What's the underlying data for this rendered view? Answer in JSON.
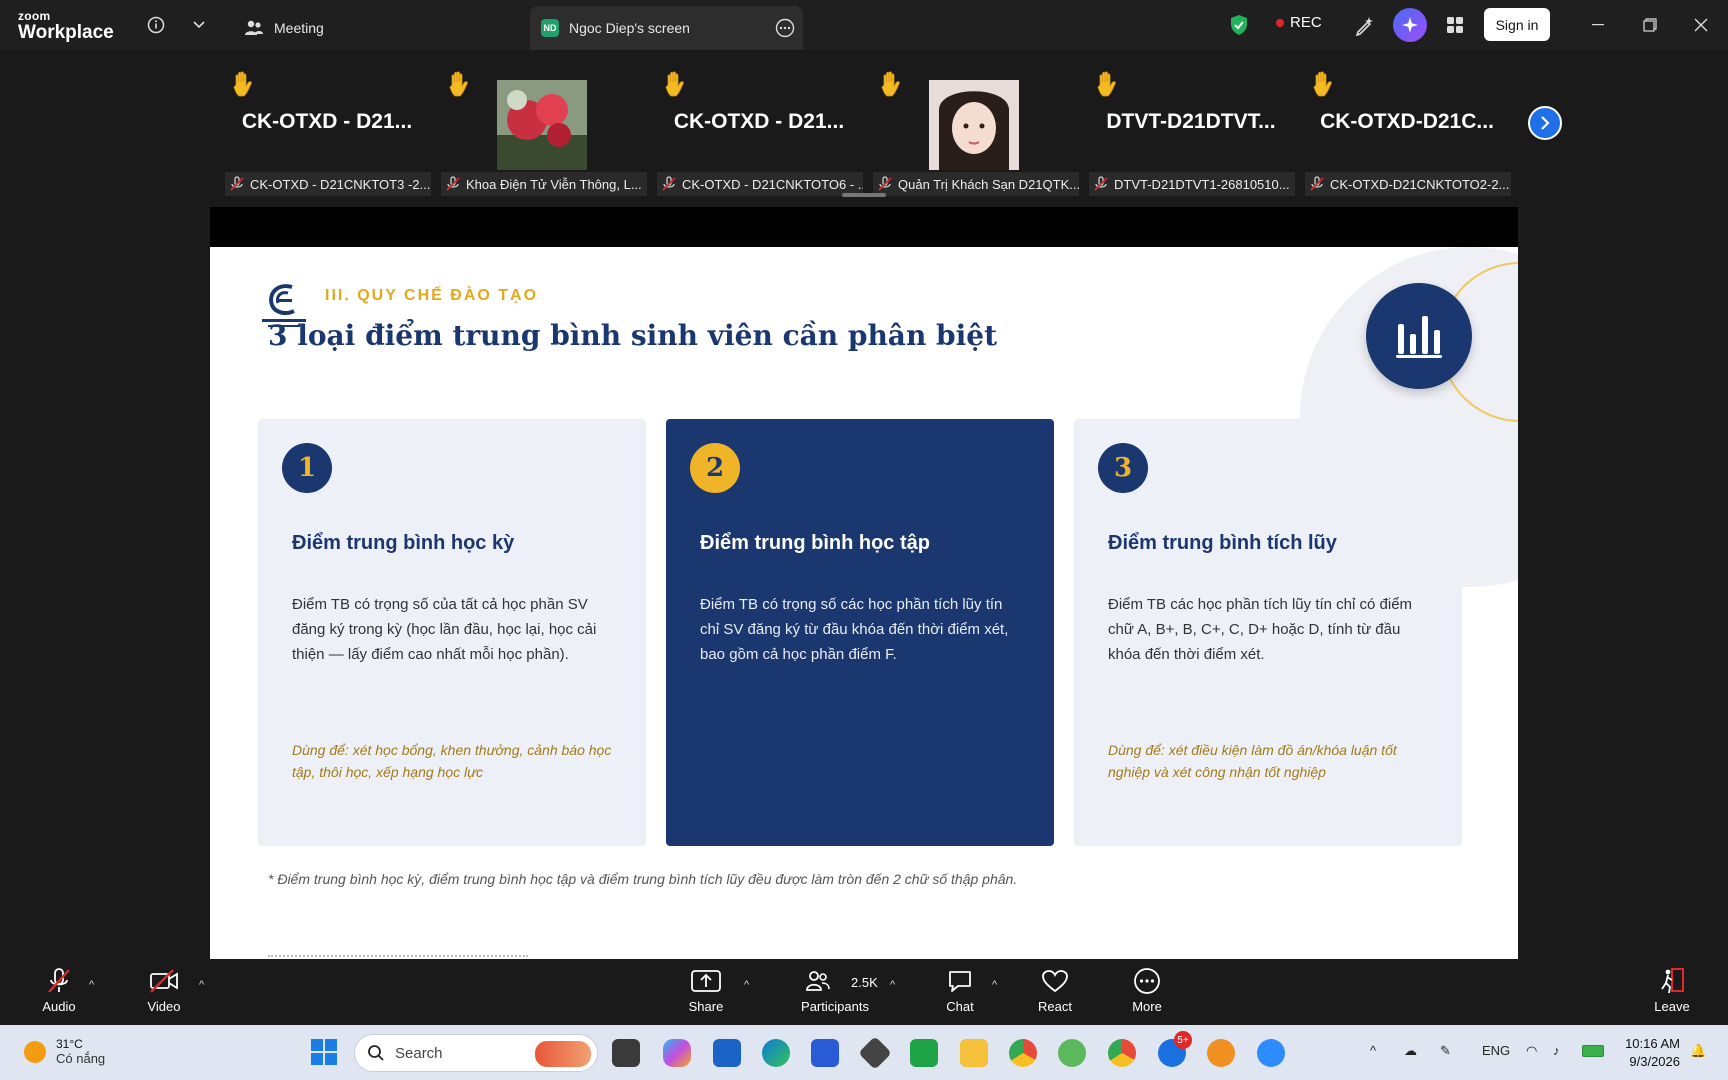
{
  "titlebar": {
    "logo_line1": "zoom",
    "logo_line2": "Workplace",
    "tab_meeting": "Meeting",
    "tab_screen_badge": "ND",
    "tab_screen": "Ngoc Diep's screen",
    "rec": "REC",
    "sign_in": "Sign in"
  },
  "participants": [
    {
      "big_name": "CK-OTXD - D21...",
      "label": "CK-OTXD - D21CNKTOT3 -2...",
      "has_photo": false
    },
    {
      "big_name": "",
      "label": "Khoa Điện Tử Viễn Thông, L...",
      "has_photo": true,
      "photo": "flower"
    },
    {
      "big_name": "CK-OTXD - D21...",
      "label": "CK-OTXD - D21CNKTOTO6 - ...",
      "has_photo": false
    },
    {
      "big_name": "",
      "label": "Quản Trị Khách Sạn D21QTK...",
      "has_photo": true,
      "photo": "girl"
    },
    {
      "big_name": "DTVT-D21DTVT...",
      "label": "DTVT-D21DTVT1-26810510...",
      "has_photo": false
    },
    {
      "big_name": "CK-OTXD-D21C...",
      "label": "CK-OTXD-D21CNKTOTO2-2...",
      "has_photo": false
    }
  ],
  "slide": {
    "section": "III. QUY CHẾ ĐÀO TẠO",
    "title": "3 loại điểm trung bình sinh viên cần phân biệt",
    "cards": [
      {
        "number": "1",
        "title": "Điểm trung bình học kỳ",
        "body": "Điểm TB có trọng số của tất cả học phần SV đăng ký trong kỳ (học lần đầu, học lại, học cải thiện — lấy điểm cao nhất mỗi học phần).",
        "use": "Dùng để: xét học bổng, khen thưởng, cảnh báo học tập, thôi học, xếp hạng học lực"
      },
      {
        "number": "2",
        "title": "Điểm trung bình học tập",
        "body": "Điểm TB có trọng số các học phần tích lũy tín chỉ SV đăng ký từ đầu khóa đến thời điểm xét, bao gồm cả học phần điểm F.",
        "use": ""
      },
      {
        "number": "3",
        "title": "Điểm trung bình tích lũy",
        "body": "Điểm TB các học phần tích lũy tín chỉ có điểm chữ A, B+, B, C+, C, D+ hoặc D, tính từ đầu khóa đến thời điểm xét.",
        "use": "Dùng để: xét điều kiện làm đồ án/khóa luận tốt nghiệp và xét công nhận tốt nghiệp"
      }
    ],
    "footnote": "* Điểm trung bình học kỳ, điểm trung bình học tập và điểm trung bình tích lũy đều được làm tròn đến 2 chữ số thập phân.",
    "colors": {
      "navy": "#1b3770",
      "gold": "#f0b429",
      "card_bg": "#eef0f8"
    }
  },
  "toolbar": {
    "audio": "Audio",
    "video": "Video",
    "share": "Share",
    "participants": "Participants",
    "participants_count": "2.5K",
    "chat": "Chat",
    "react": "React",
    "more": "More",
    "leave": "Leave"
  },
  "taskbar": {
    "temp": "31°C",
    "weather": "Có nắng",
    "search": "Search",
    "zalo_badge": "5+",
    "lang": "ENG",
    "time": "10:16 AM",
    "date": "9/3/2026"
  }
}
